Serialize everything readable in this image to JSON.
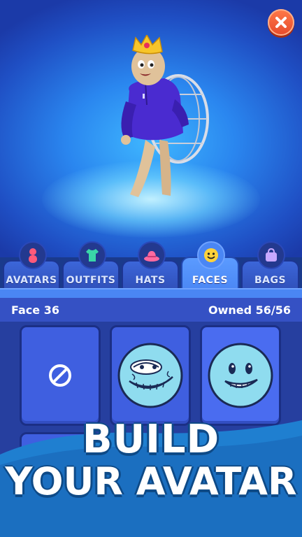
{
  "tabs": [
    {
      "label": "AVATARS",
      "icon": "person-icon",
      "active": false
    },
    {
      "label": "OUTFITS",
      "icon": "shirt-icon",
      "active": false
    },
    {
      "label": "HATS",
      "icon": "hat-icon",
      "active": false
    },
    {
      "label": "FACES",
      "icon": "smiley-icon",
      "active": true
    },
    {
      "label": "BAGS",
      "icon": "bag-icon",
      "active": false
    }
  ],
  "info": {
    "selected_item": "Face 36",
    "owned": "Owned 56/56"
  },
  "face_cards": [
    {
      "kind": "none",
      "icon": "no-entry-icon"
    },
    {
      "kind": "face",
      "icon": "trollface-icon"
    },
    {
      "kind": "face",
      "icon": "grin-face-icon",
      "selected": true
    }
  ],
  "promo": {
    "line1": "BUILD",
    "line2": "YOUR AVATAR"
  },
  "colors": {
    "accent": "#4a86f4",
    "close": "#e64a2a",
    "face": "#8fdcef"
  }
}
